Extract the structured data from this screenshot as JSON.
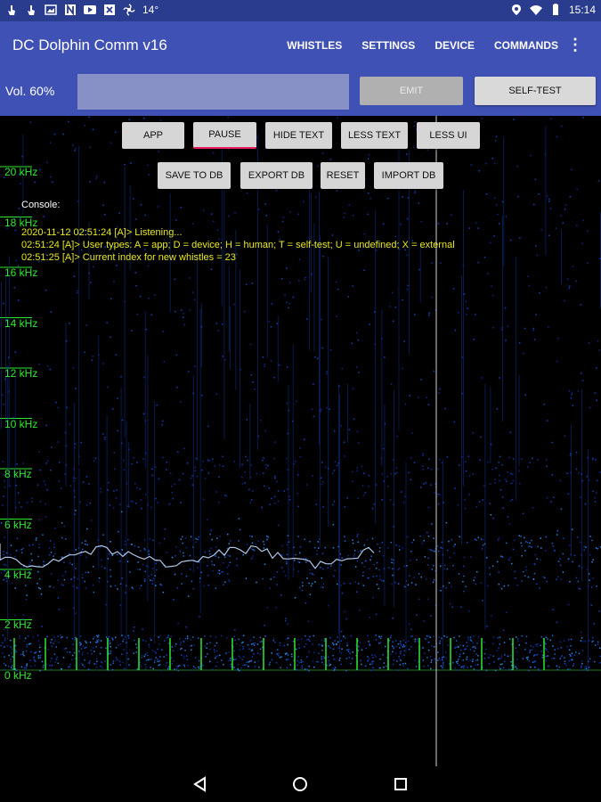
{
  "statusbar": {
    "left_icons": [
      "touch-icon",
      "touch-icon",
      "image-icon",
      "n-icon",
      "youtube-icon",
      "x-icon",
      "fan-icon"
    ],
    "temperature": "14°",
    "time": "15:14",
    "right_icons": [
      "location-icon",
      "wifi-icon",
      "battery-icon"
    ]
  },
  "appbar": {
    "title": "DC Dolphin Comm v16",
    "menu": [
      "WHISTLES",
      "SETTINGS",
      "DEVICE",
      "COMMANDS"
    ]
  },
  "volume": {
    "label": "Vol. 60%",
    "value_percent": 60,
    "emit_label": "EMIT",
    "selftest_label": "SELF-TEST"
  },
  "controls": {
    "row1": [
      "APP",
      "PAUSE",
      "HIDE TEXT",
      "LESS TEXT",
      "LESS UI"
    ],
    "row2": [
      "SAVE TO DB",
      "EXPORT DB",
      "RESET",
      "IMPORT DB"
    ]
  },
  "console": {
    "title": "Console:",
    "lines": [
      "2020-11-12 02:51:24 [A]> Listening...",
      "02:51:24 [A]> User types: A = app; D = device; H = human; T = self-test; U = undefined; X = external",
      "02:51:25 [A]> Current index for new whistles = 23"
    ]
  },
  "frequency_axis": [
    "20 kHz",
    "18 kHz",
    "16 kHz",
    "14 kHz",
    "12 kHz",
    "10 kHz",
    "8 kHz",
    "6 kHz",
    "4 kHz",
    "2 kHz",
    "0 kHz"
  ],
  "colors": {
    "appbar": "#3f51b5",
    "statusbar": "#2a3c8e",
    "freq_label": "#2ee82e",
    "console_text": "#e8e820",
    "active_underline": "#e91e63"
  },
  "navbar": {
    "icons": [
      "back-icon",
      "home-icon",
      "recents-icon"
    ]
  }
}
